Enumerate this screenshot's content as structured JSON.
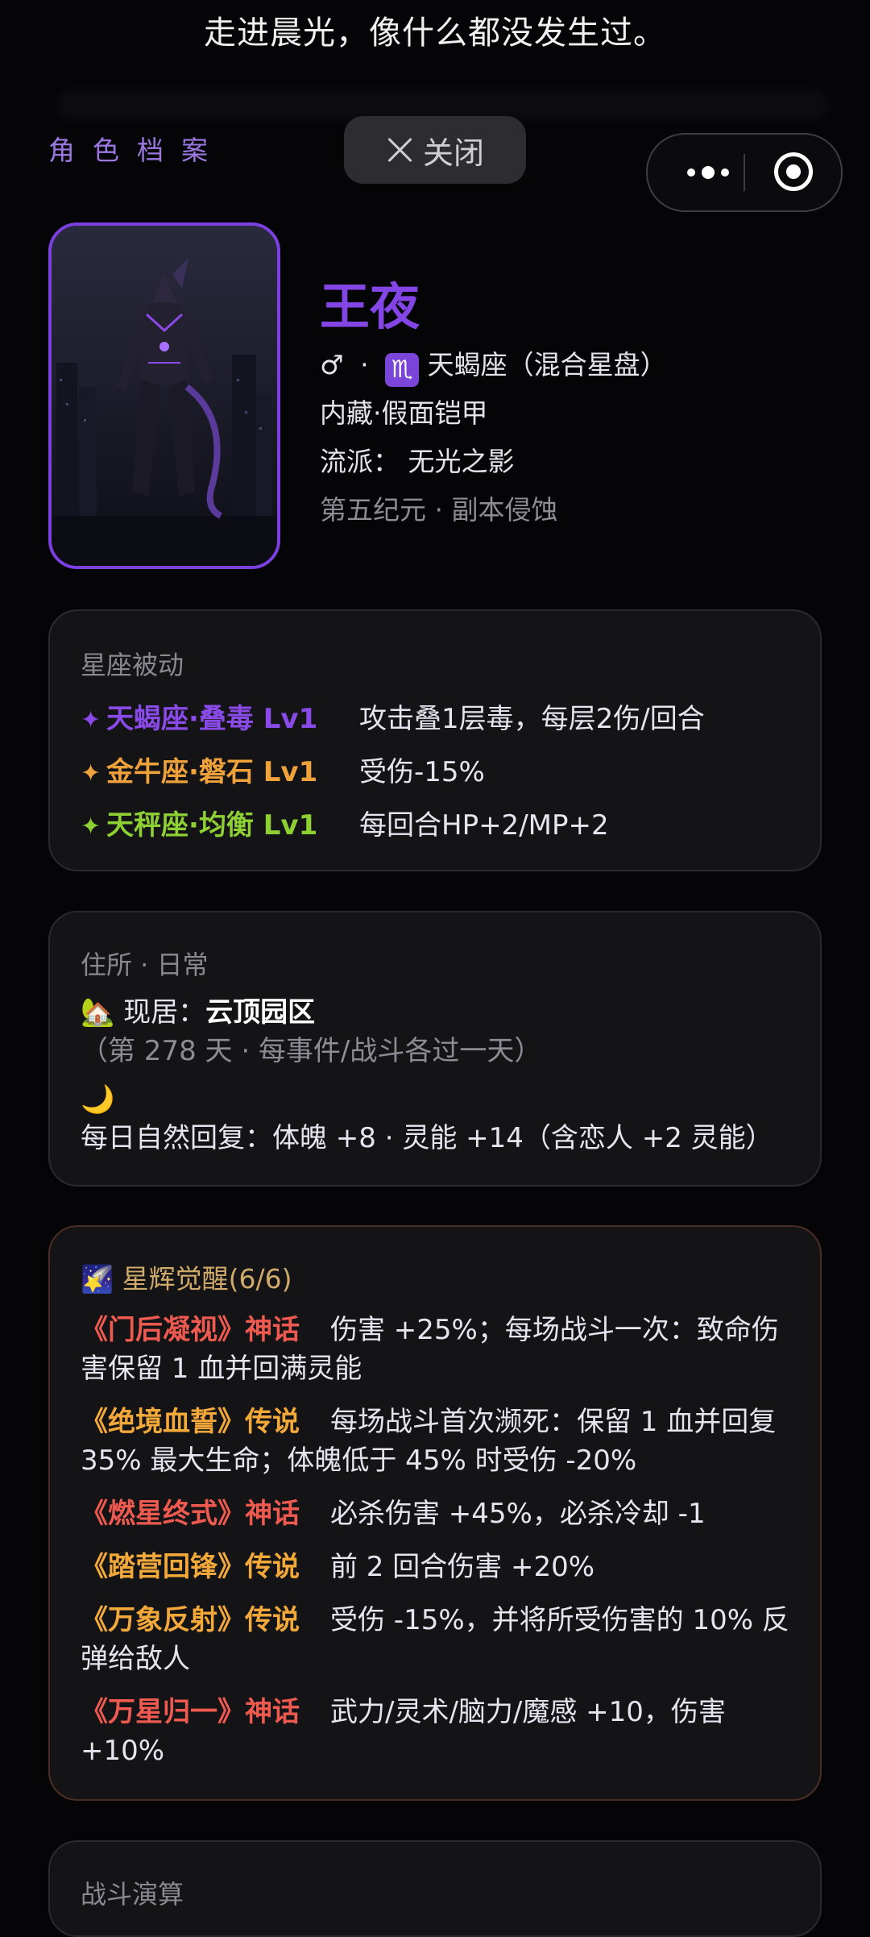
{
  "header": {
    "quote": "走进晨光，像什么都没发生过。",
    "archive_label": "角色档案",
    "close_label": "关闭"
  },
  "profile": {
    "name": "王夜",
    "gender_symbol": "♂",
    "dot": "·",
    "zodiac_symbol": "♏",
    "zodiac_text": "天蝎座（混合星盘）",
    "hidden": "内藏·假面铠甲",
    "school": "流派：  无光之影",
    "era": "第五纪元 · 副本侵蚀"
  },
  "constellation": {
    "title": "星座被动",
    "items": [
      {
        "star": "✦",
        "name": "天蝎座·叠毒 Lv1",
        "desc": "攻击叠1层毒，每层2伤/回合",
        "color": "#8a4ae8"
      },
      {
        "star": "✦",
        "name": "金牛座·磐石 Lv1",
        "desc": "受伤-15%",
        "color": "#f0a23a"
      },
      {
        "star": "✦",
        "name": "天秤座·均衡 Lv1",
        "desc": "每回合HP+2/MP+2",
        "color": "#8ed033"
      }
    ]
  },
  "residence": {
    "title": "住所 · 日常",
    "home_icon": "🏡",
    "home_label": "现居：",
    "home_name": "云顶园区",
    "home_note": "（第 278 天 · 每事件/战斗各过一天）",
    "moon_icon": "🌙",
    "recovery_text": "每日自然回复：体魄 +8 · 灵能 +14（含恋人 +2 灵能）"
  },
  "awakening": {
    "icon": "🌠",
    "title": "星辉觉醒(6/6)",
    "items": [
      {
        "name": "《门后凝视》神话",
        "tier": "myth",
        "desc": "伤害 +25%；每场战斗一次：致命伤害保留 1 血并回满灵能"
      },
      {
        "name": "《绝境血誓》传说",
        "tier": "legend",
        "desc": "每场战斗首次濒死：保留 1 血并回复 35% 最大生命；体魄低于 45% 时受伤 -20%"
      },
      {
        "name": "《燃星终式》神话",
        "tier": "myth",
        "desc": "必杀伤害 +45%，必杀冷却 -1"
      },
      {
        "name": "《踏营回锋》传说",
        "tier": "legend",
        "desc": "前 2 回合伤害 +20%"
      },
      {
        "name": "《万象反射》传说",
        "tier": "legend",
        "desc": "受伤 -15%，并将所受伤害的 10% 反弹给敌人"
      },
      {
        "name": "《万星归一》神话",
        "tier": "myth",
        "desc": "武力/灵术/脑力/魔感 +10，伤害 +10%"
      }
    ]
  },
  "battle": {
    "title": "战斗演算"
  }
}
